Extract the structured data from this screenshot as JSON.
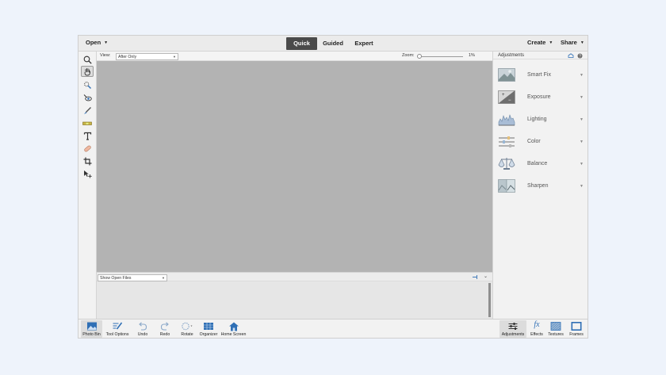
{
  "menubar": {
    "open_label": "Open",
    "modes": [
      {
        "label": "Quick",
        "active": true
      },
      {
        "label": "Guided",
        "active": false
      },
      {
        "label": "Expert",
        "active": false
      }
    ],
    "create_label": "Create",
    "share_label": "Share"
  },
  "toolbox": {
    "tools": [
      {
        "name": "zoom-tool",
        "icon": "magnifier-icon",
        "selected": false
      },
      {
        "name": "hand-tool",
        "icon": "hand-icon",
        "selected": true
      },
      {
        "name": "quick-selection-tool",
        "icon": "quick-selection-icon",
        "selected": false
      },
      {
        "name": "red-eye-tool",
        "icon": "eye-icon",
        "selected": false
      },
      {
        "name": "whiten-teeth-tool",
        "icon": "brush-icon",
        "selected": false
      },
      {
        "name": "straighten-tool",
        "icon": "level-icon",
        "selected": false
      },
      {
        "name": "type-tool",
        "icon": "type-icon",
        "selected": false
      },
      {
        "name": "spot-healing-tool",
        "icon": "bandage-icon",
        "selected": false
      },
      {
        "name": "crop-tool",
        "icon": "crop-icon",
        "selected": false
      },
      {
        "name": "move-tool",
        "icon": "move-icon",
        "selected": false
      }
    ]
  },
  "optionsbar": {
    "view_label": "View:",
    "view_value": "After Only",
    "zoom_label": "Zoom:",
    "zoom_value": "1%",
    "zoom_fraction": 0.0
  },
  "panel": {
    "title": "Adjustments",
    "items": [
      {
        "label": "Smart Fix",
        "icon": "smart-fix-icon"
      },
      {
        "label": "Exposure",
        "icon": "exposure-icon"
      },
      {
        "label": "Lighting",
        "icon": "lighting-icon"
      },
      {
        "label": "Color",
        "icon": "color-icon"
      },
      {
        "label": "Balance",
        "icon": "balance-icon"
      },
      {
        "label": "Sharpen",
        "icon": "sharpen-icon"
      }
    ]
  },
  "bin": {
    "show_value": "Show Open Files"
  },
  "taskbar": {
    "left": [
      {
        "label": "Photo Bin",
        "icon": "photo-bin-icon"
      },
      {
        "label": "Tool Options",
        "icon": "tool-options-icon"
      },
      {
        "label": "Undo",
        "icon": "undo-icon"
      },
      {
        "label": "Redo",
        "icon": "redo-icon"
      },
      {
        "label": "Rotate",
        "icon": "rotate-icon"
      },
      {
        "label": "Organizer",
        "icon": "organizer-icon"
      },
      {
        "label": "Home Screen",
        "icon": "home-icon"
      }
    ],
    "right": [
      {
        "label": "Adjustments",
        "icon": "adjustments-icon"
      },
      {
        "label": "Effects",
        "icon": "fx-icon"
      },
      {
        "label": "Textures",
        "icon": "textures-icon"
      },
      {
        "label": "Frames",
        "icon": "frames-icon"
      }
    ]
  },
  "colors": {
    "app_bg": "#eef3fb",
    "canvas": "#b3b3b3",
    "active_tab": "#4a4a4a",
    "accent_blue": "#2f6fb5"
  }
}
